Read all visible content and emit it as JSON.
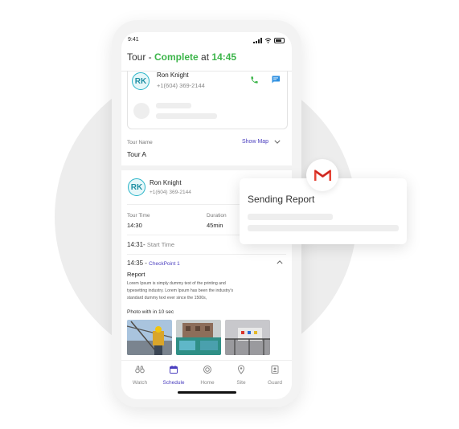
{
  "status_bar": {
    "time": "9:41"
  },
  "header": {
    "prefix": "Tour - ",
    "status": "Complete",
    "mid": " at ",
    "time": "14:45"
  },
  "contact_card": {
    "initials": "RK",
    "name": "Ron Knight",
    "phone": "+1(604) 369-2144"
  },
  "tour": {
    "label": "Tour Name",
    "value": "Tour A",
    "show_map": "Show Map"
  },
  "guard": {
    "initials": "RK",
    "name": "Ron Knight",
    "phone": "+1(604) 369-2144"
  },
  "tour_time": {
    "label": "Tour Time",
    "value": "14:30"
  },
  "duration": {
    "label": "Duration",
    "value": "45min"
  },
  "timeline": {
    "start_time": "14:31",
    "start_sep": "- ",
    "start_label": "Start Time",
    "checkpoint_time": "14:35",
    "checkpoint_sep": " - ",
    "checkpoint_label": "CheckPoint 1"
  },
  "report": {
    "title": "Report",
    "line1": "Lorem Ipsum is simply dummy text of the printing and",
    "line2": "typesetting industry. Lorem Ipsum has been the industry's",
    "line3": "standard dummy text ever since the 1500s,"
  },
  "photos_label": "Photo with in 10 sec",
  "tabs": [
    {
      "label": "Watch",
      "icon": "binoculars-icon"
    },
    {
      "label": "Schedule",
      "icon": "calendar-icon"
    },
    {
      "label": "Home",
      "icon": "home-icon"
    },
    {
      "label": "Site",
      "icon": "location-pin-icon"
    },
    {
      "label": "Guard",
      "icon": "id-badge-icon"
    }
  ],
  "popup": {
    "title": "Sending Report"
  },
  "colors": {
    "accent_green": "#3cb54a",
    "active_tab": "#4b3fbf",
    "avatar_teal": "#28b4c8",
    "gmail_red": "#e54335"
  }
}
